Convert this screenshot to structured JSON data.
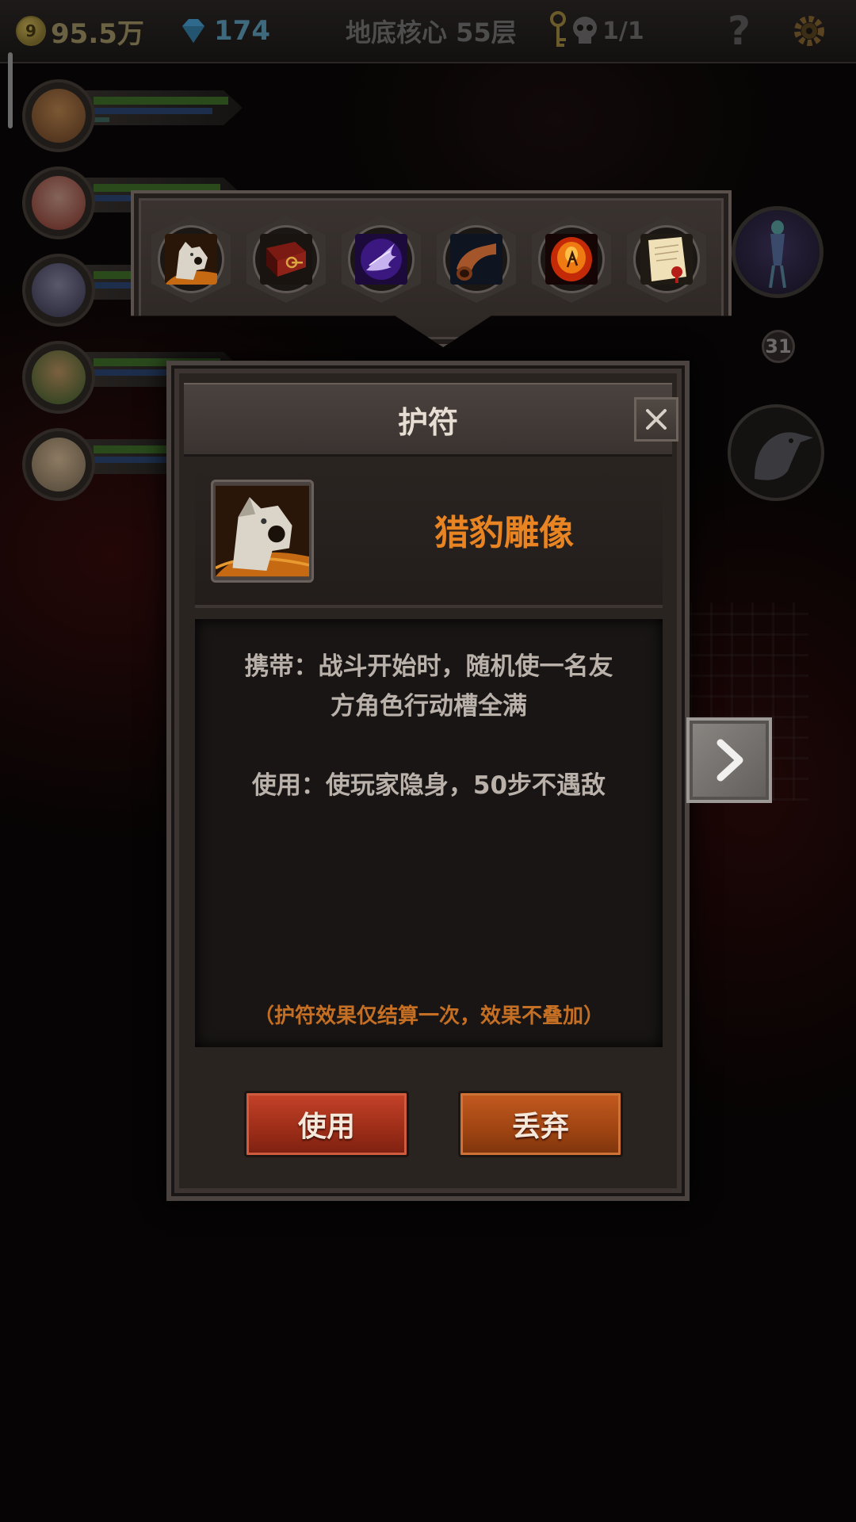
{
  "topbar": {
    "gold_icon": "coin-icon",
    "gold_icon_label": "9",
    "gold": "95.5万",
    "gems": "174",
    "floor": "地底核心 55层",
    "skull_count": "1/1",
    "help": "?"
  },
  "party": {
    "heroes": [
      "hero-1",
      "hero-2",
      "hero-3",
      "hero-4",
      "hero-5"
    ]
  },
  "amulets": {
    "slots": [
      {
        "name": "猎豹雕像",
        "icon": "leopard-statue-icon"
      },
      {
        "name": "",
        "icon": "red-book-icon"
      },
      {
        "name": "",
        "icon": "purple-wing-icon"
      },
      {
        "name": "",
        "icon": "horn-icon"
      },
      {
        "name": "",
        "icon": "amber-icon"
      },
      {
        "name": "",
        "icon": "scroll-letter-icon"
      }
    ],
    "side_level": "31"
  },
  "dialog": {
    "title": "护符",
    "item_name": "猎豹雕像",
    "carry_line1": "携带：战斗开始时，随机使一名友",
    "carry_line2": "方角色行动槽全满",
    "use_text": "使用：使玩家隐身，50步不遇敌",
    "note": "（护符效果仅结算一次，效果不叠加）",
    "use_button": "使用",
    "drop_button": "丢弃"
  },
  "colors": {
    "item_name": "#e98422",
    "note": "#c46f23",
    "use_button": "#b33720",
    "drop_button": "#ad4d17"
  }
}
